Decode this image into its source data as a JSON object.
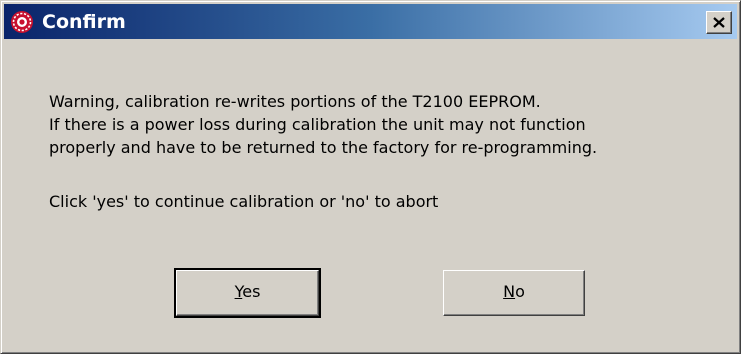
{
  "window": {
    "title": "Confirm",
    "title_icon": "app-icon",
    "close_icon": "close-icon"
  },
  "message": {
    "lines": [
      "Warning, calibration re-writes portions of the T2100 EEPROM.",
      "If there is a power loss during calibration the unit may not function",
      "properly and have to be returned to the factory for re-programming."
    ],
    "prompt": "Click 'yes' to continue calibration or 'no' to abort"
  },
  "buttons": {
    "yes": {
      "mnemonic": "Y",
      "rest": "es"
    },
    "no": {
      "mnemonic": "N",
      "rest": "o"
    }
  },
  "colors": {
    "title_gradient_start": "#0a246a",
    "title_gradient_end": "#a6caf0",
    "face": "#d4d0c8",
    "icon_red": "#c8102e"
  }
}
